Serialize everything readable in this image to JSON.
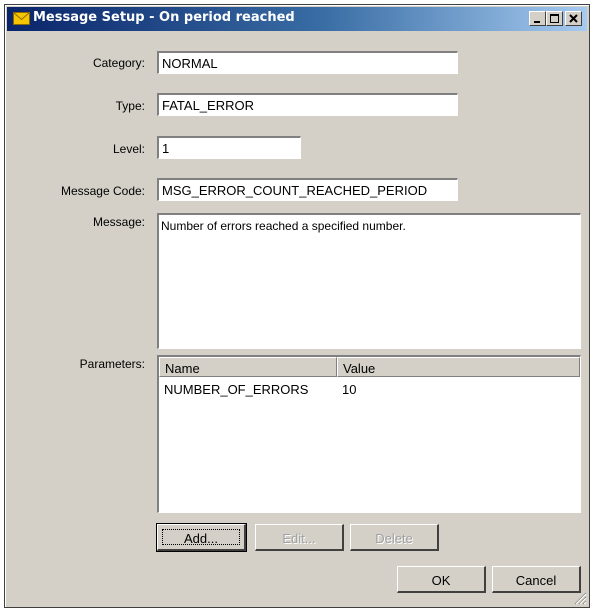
{
  "window": {
    "title": "Message Setup - On period reached"
  },
  "fields": {
    "category": {
      "label": "Category:",
      "value": "NORMAL"
    },
    "type": {
      "label": "Type:",
      "value": "FATAL_ERROR"
    },
    "level": {
      "label": "Level:",
      "value": "1"
    },
    "message_code": {
      "label": "Message Code:",
      "value": "MSG_ERROR_COUNT_REACHED_PERIOD"
    },
    "message": {
      "label": "Message:",
      "value": "Number of errors reached a specified number."
    }
  },
  "parameters": {
    "label": "Parameters:",
    "columns": [
      "Name",
      "Value"
    ],
    "rows": [
      {
        "name": "NUMBER_OF_ERRORS",
        "value": "10"
      }
    ]
  },
  "buttons": {
    "add": "Add...",
    "edit": "Edit...",
    "delete": "Delete",
    "ok": "OK",
    "cancel": "Cancel"
  },
  "colors": {
    "titlebar_start": "#0a246a",
    "titlebar_end": "#a6caf0",
    "face": "#d4d0c8"
  }
}
